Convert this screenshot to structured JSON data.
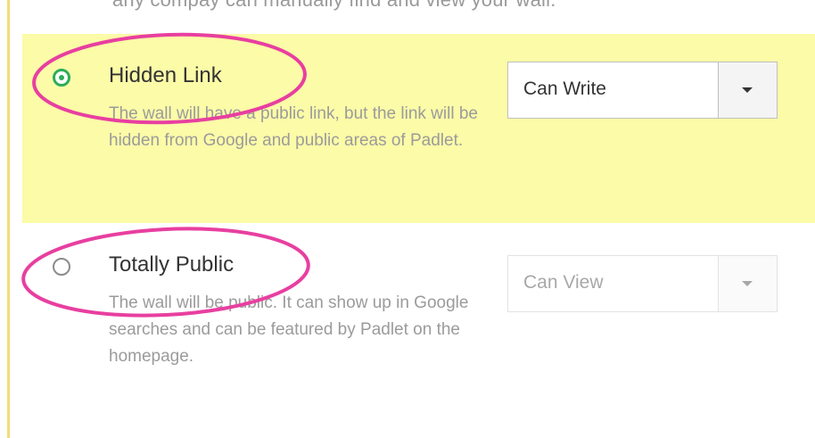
{
  "cut_text": "any compay can manually find and view your wall.",
  "options": [
    {
      "id": "hidden-link",
      "selected": true,
      "title": "Hidden Link",
      "description": "The wall will have a public link, but the link will be hidden from Google and public areas of Padlet.",
      "permission": "Can Write",
      "permission_enabled": true
    },
    {
      "id": "totally-public",
      "selected": false,
      "title": "Totally Public",
      "description": "The wall will be public. It can show up in Google searches and can be featured by Padlet on the homepage.",
      "permission": "Can View",
      "permission_enabled": false
    }
  ],
  "colors": {
    "highlight_background": "#fbfba8",
    "radio_selected": "#2cad5a",
    "annotation_ellipse": "#e83fa0",
    "left_rule": "#f2dc7a"
  }
}
